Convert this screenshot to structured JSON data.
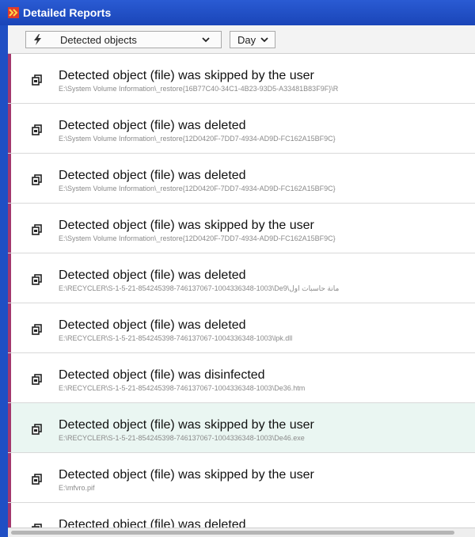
{
  "window": {
    "title": "Detailed Reports",
    "icon": "app-logo-icon"
  },
  "toolbar": {
    "filter_dropdown": {
      "icon": "lightning-icon",
      "selected": "Detected objects"
    },
    "period_dropdown": {
      "selected": "Day"
    }
  },
  "colors": {
    "titlebar": "#1f4fc4",
    "row_marker": "#a4376d",
    "highlight_row": "#eaf6f2"
  },
  "events": [
    {
      "title": "Detected object (file) was skipped by the user",
      "path": "E:\\System Volume Information\\_restore{16B77C40-34C1-4B23-93D5-A33481B83F9F}\\R",
      "highlighted": false
    },
    {
      "title": "Detected object (file) was deleted",
      "path": "E:\\System Volume Information\\_restore{12D0420F-7DD7-4934-AD9D-FC162A15BF9C}",
      "highlighted": false
    },
    {
      "title": "Detected object (file) was deleted",
      "path": "E:\\System Volume Information\\_restore{12D0420F-7DD7-4934-AD9D-FC162A15BF9C}",
      "highlighted": false
    },
    {
      "title": "Detected object (file) was skipped by the user",
      "path": "E:\\System Volume Information\\_restore{12D0420F-7DD7-4934-AD9D-FC162A15BF9C}",
      "highlighted": false
    },
    {
      "title": "Detected object (file) was deleted",
      "path": "E:\\RECYCLER\\S-1-5-21-854245398-746137067-1004336348-1003\\De9\\مانة حاسبات اول",
      "highlighted": false
    },
    {
      "title": "Detected object (file) was deleted",
      "path": "E:\\RECYCLER\\S-1-5-21-854245398-746137067-1004336348-1003\\lpk.dll",
      "highlighted": false
    },
    {
      "title": "Detected object (file) was disinfected",
      "path": "E:\\RECYCLER\\S-1-5-21-854245398-746137067-1004336348-1003\\De36.htm",
      "highlighted": false
    },
    {
      "title": "Detected object (file) was skipped by the user",
      "path": "E:\\RECYCLER\\S-1-5-21-854245398-746137067-1004336348-1003\\De46.exe",
      "highlighted": true
    },
    {
      "title": "Detected object (file) was skipped by the user",
      "path": "E:\\mfvro.pif",
      "highlighted": false
    },
    {
      "title": "Detected object (file) was deleted",
      "path": "",
      "highlighted": false
    }
  ]
}
